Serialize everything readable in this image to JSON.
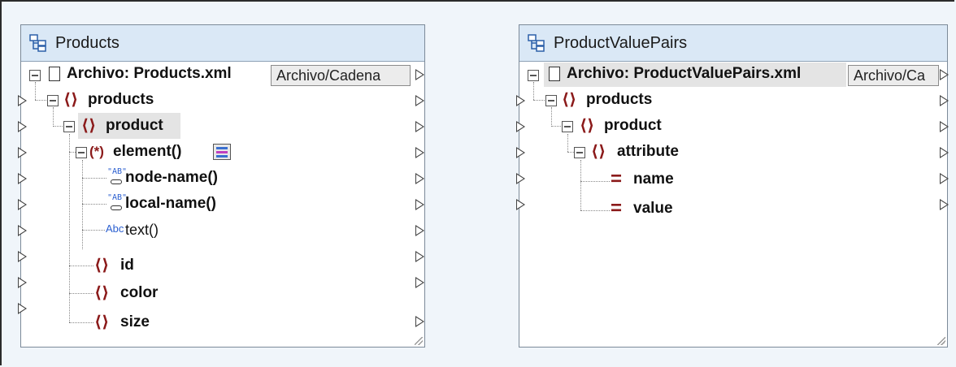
{
  "left_component": {
    "title": "Products",
    "file_label": "Archivo: Products.xml",
    "file_button": "Archivo/Cadena",
    "nodes": {
      "products": "products",
      "product": "product",
      "element": "element()",
      "node_name": "node-name()",
      "local_name": "local-name()",
      "text": "text()",
      "id": "id",
      "color": "color",
      "size": "size"
    },
    "icon_texts": {
      "ab1": "\"AB\"",
      "ab2": "\"AB\"",
      "abc": "Abc",
      "star": "(*)"
    }
  },
  "right_component": {
    "title": "ProductValuePairs",
    "file_label": "Archivo: ProductValuePairs.xml",
    "file_button": "Archivo/Ca",
    "nodes": {
      "products": "products",
      "product": "product",
      "attribute": "attribute",
      "name": "name",
      "value": "value"
    }
  },
  "colors": {
    "header_bg": "#dae8f6",
    "element_brace": "#8b1a1a",
    "canvas_bg": "#f0f5fa"
  }
}
